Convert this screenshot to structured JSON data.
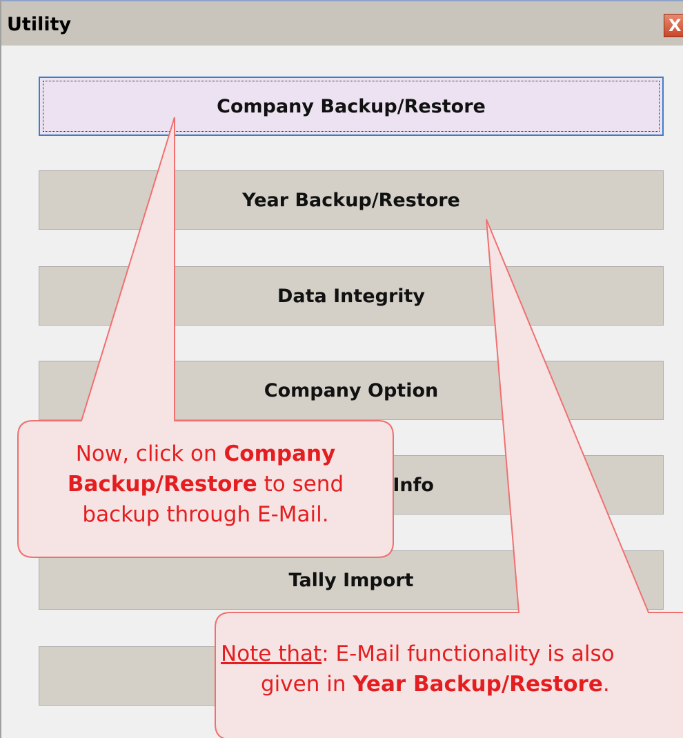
{
  "window": {
    "title": "Utility",
    "close_label": "X"
  },
  "buttons": [
    {
      "label": "Company Backup/Restore",
      "focused": true
    },
    {
      "label": "Year Backup/Restore"
    },
    {
      "label": "Data Integrity"
    },
    {
      "label": "Company Option"
    },
    {
      "label": "Company Info"
    },
    {
      "label": "Tally Import"
    },
    {
      "label": ""
    }
  ],
  "callout_1": {
    "line1_pre": "Now, click on ",
    "line1_bold": "Company",
    "line2_bold": "Backup/Restore",
    "line2_post": " to send",
    "line3": "backup through E-Mail."
  },
  "callout_2": {
    "note_label": "Note that",
    "line1_post": ": E-Mail functionality is also",
    "line2_pre": "given in ",
    "line2_bold": "Year Backup/Restore",
    "line2_post": "."
  },
  "colors": {
    "callout_text": "#e41e20",
    "callout_fill": "#f6e3e3",
    "callout_border": "#f07070"
  }
}
